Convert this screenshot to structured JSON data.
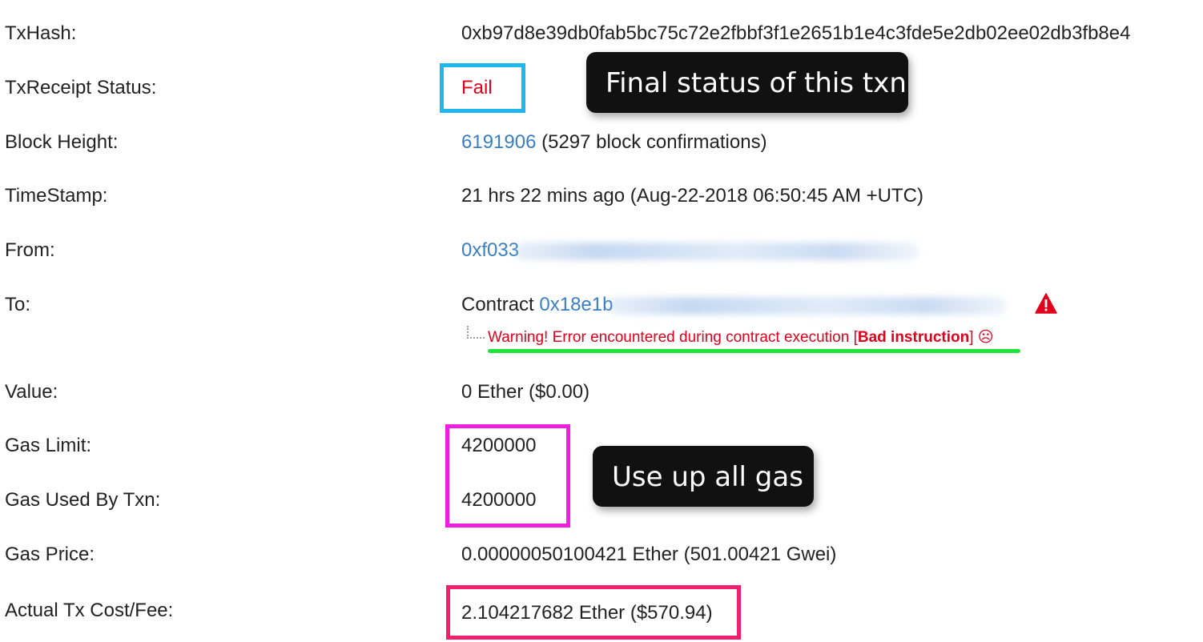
{
  "rows": {
    "txhash": {
      "label": "TxHash:",
      "value": "0xb97d8e39db0fab5bc75c72e2fbbf3f1e2651b1e4c3fde5e2db02ee02db3fb8e4"
    },
    "status": {
      "label": "TxReceipt Status:",
      "value": "Fail"
    },
    "block": {
      "label": "Block Height:",
      "link": "6191906",
      "confirmations": "(5297 block confirmations)"
    },
    "timestamp": {
      "label": "TimeStamp:",
      "value": "21 hrs 22 mins ago (Aug-22-2018 06:50:45 AM +UTC)"
    },
    "from": {
      "label": "From:",
      "link": "0xf033"
    },
    "to": {
      "label": "To:",
      "prefix": "Contract",
      "link": "0x18e1b",
      "warning_text": "Warning! Error encountered during contract execution [",
      "warning_bold": "Bad instruction",
      "warning_suffix": "] ☹"
    },
    "value": {
      "label": "Value:",
      "value": "0 Ether ($0.00)"
    },
    "gas_limit": {
      "label": "Gas Limit:",
      "value": "4200000"
    },
    "gas_used": {
      "label": "Gas Used By Txn:",
      "value": "4200000"
    },
    "gas_price": {
      "label": "Gas Price:",
      "value": "0.00000050100421 Ether (501.00421 Gwei)"
    },
    "fee": {
      "label": "Actual Tx Cost/Fee:",
      "value": "2.104217682 Ether ($570.94)"
    }
  },
  "annotations": {
    "status_tooltip": "Final status of this txn",
    "gas_tooltip": "Use up all gas"
  },
  "icons": {
    "warning": "warning-triangle-icon"
  },
  "colors": {
    "link": "#3a7fc1",
    "fail": "#e0001b",
    "status_box": "#1eb8ef",
    "gas_box": "#f01ee0",
    "fee_box": "#f0206e",
    "underline": "#1ee33a",
    "tooltip_bg": "#111111"
  }
}
